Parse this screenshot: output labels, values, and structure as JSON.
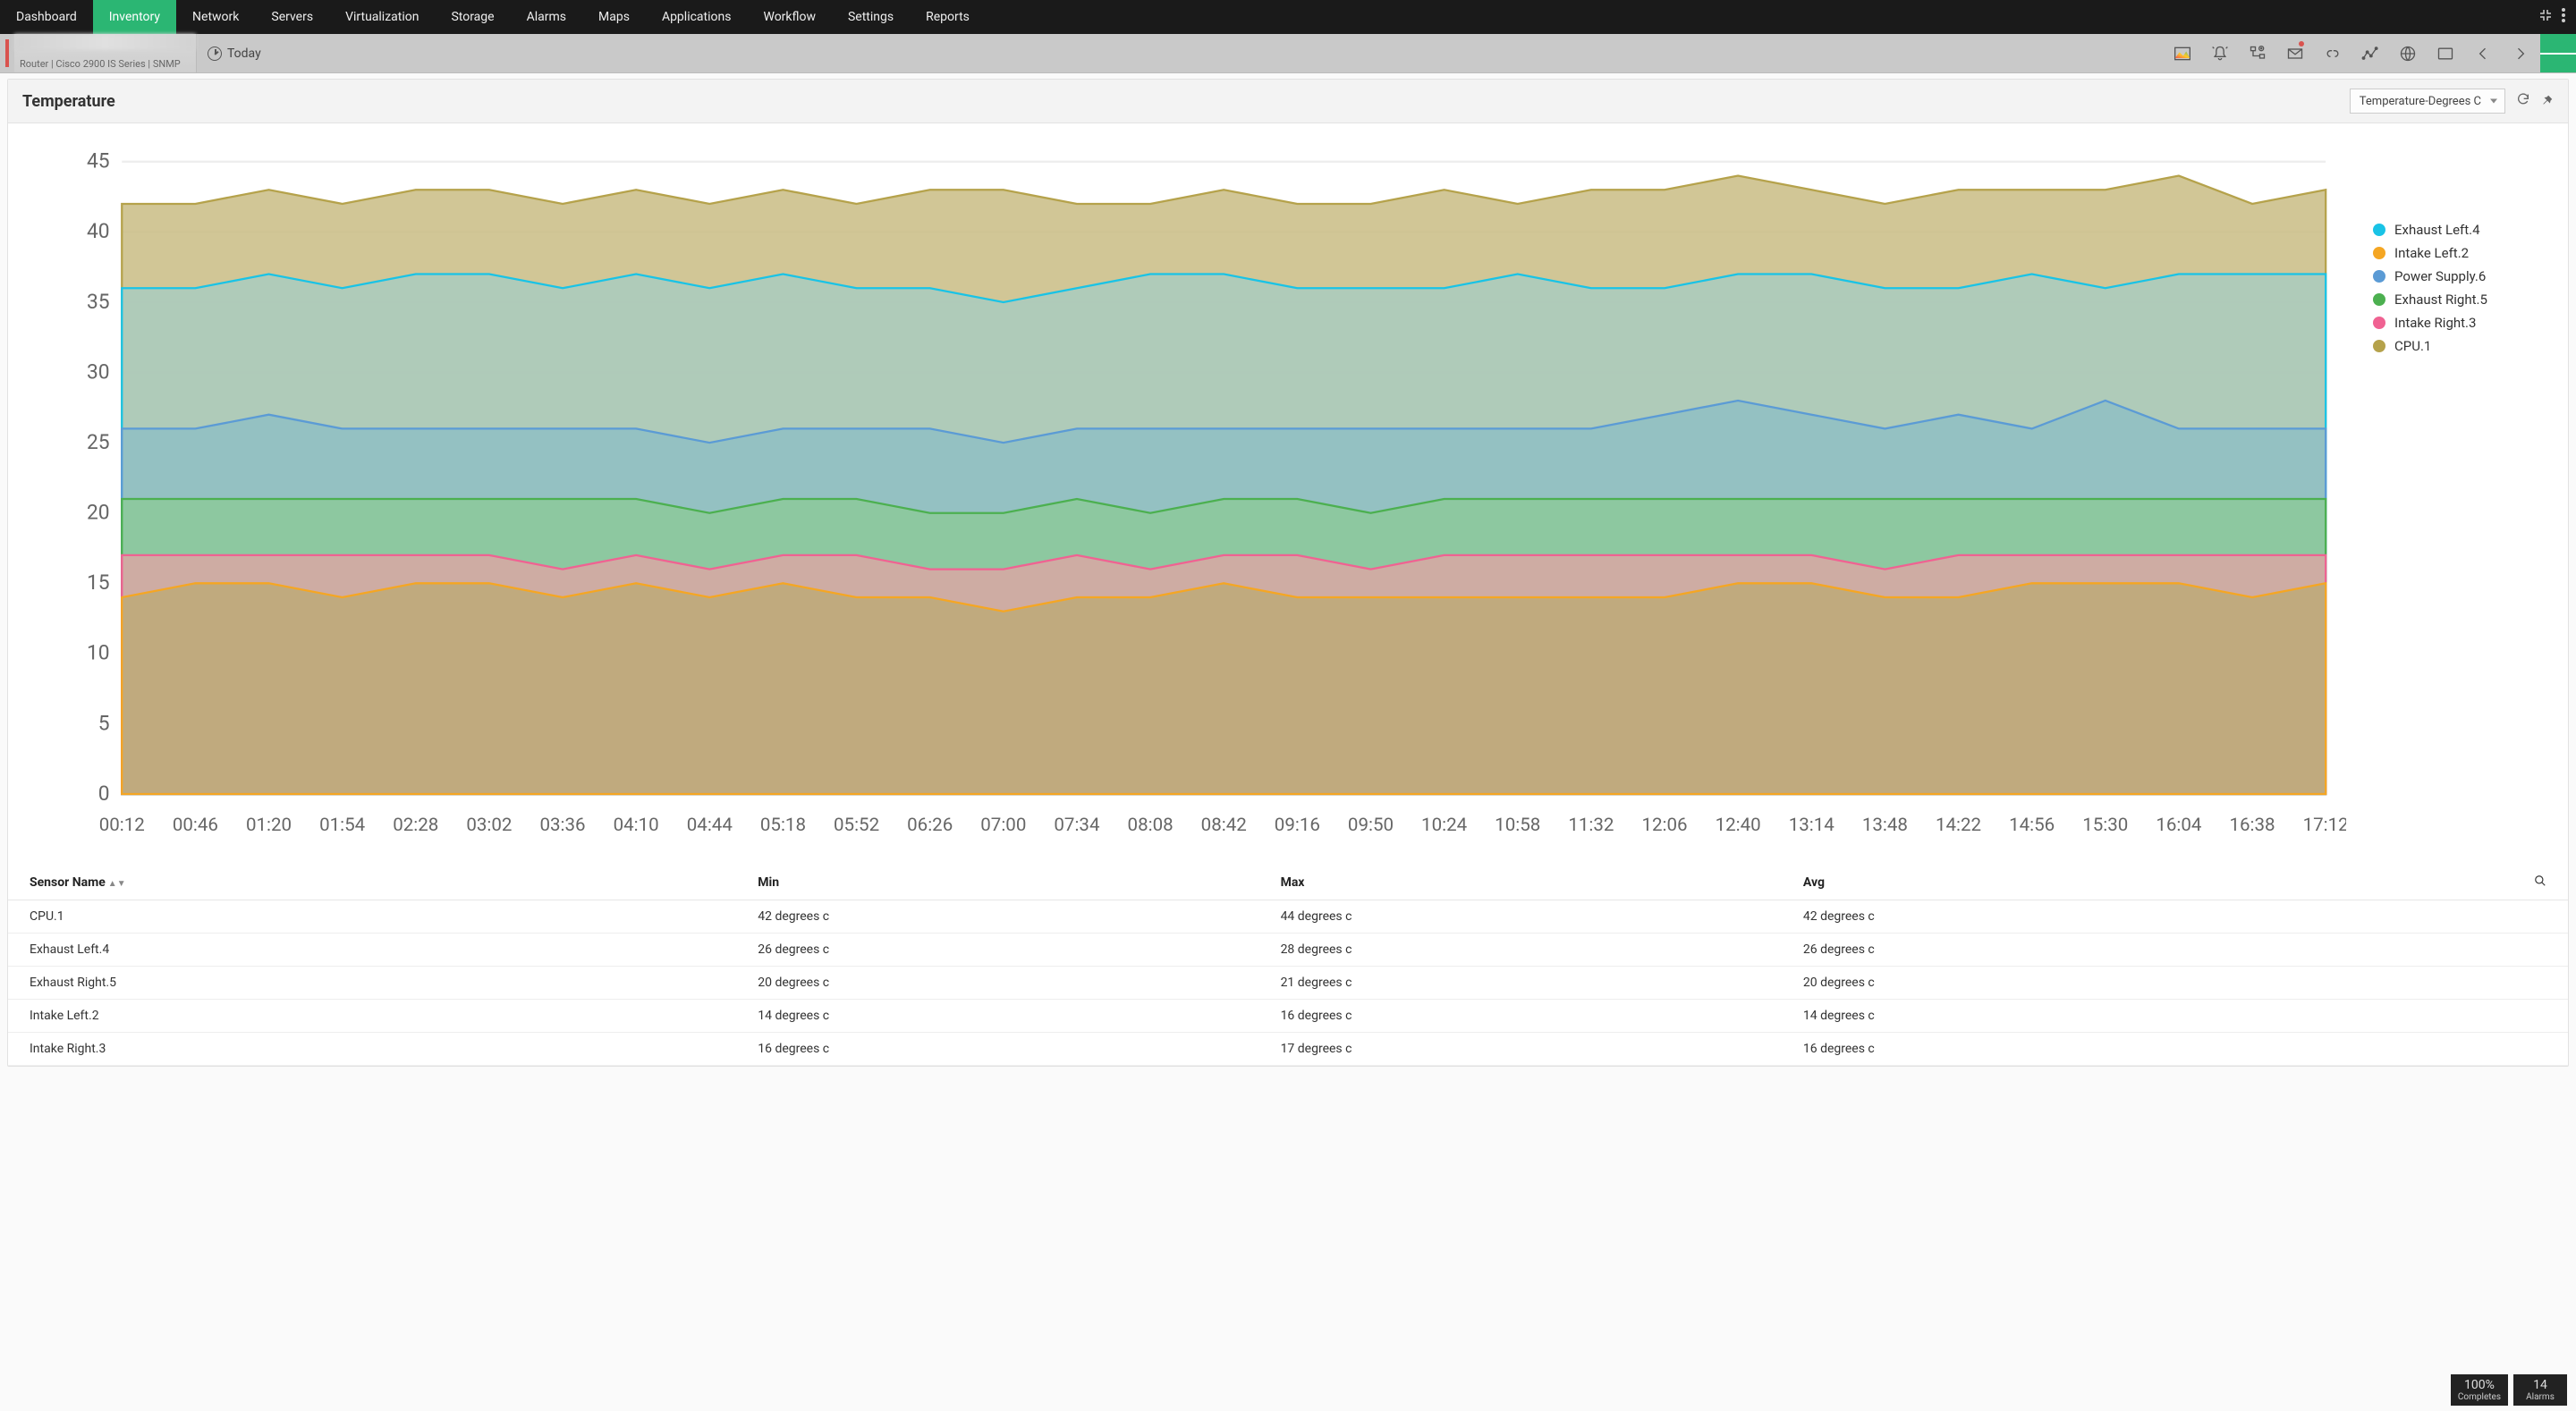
{
  "nav": {
    "items": [
      "Dashboard",
      "Inventory",
      "Network",
      "Servers",
      "Virtualization",
      "Storage",
      "Alarms",
      "Maps",
      "Applications",
      "Workflow",
      "Settings",
      "Reports"
    ],
    "active_index": 1
  },
  "subheader": {
    "device_meta": "Router | Cisco 2900 IS Series | SNMP",
    "time_label": "Today"
  },
  "card": {
    "title": "Temperature",
    "metric_select": "Temperature-Degrees C"
  },
  "legend": [
    {
      "label": "Exhaust Left.4",
      "color": "#19c3e6"
    },
    {
      "label": "Intake Left.2",
      "color": "#f5a623"
    },
    {
      "label": "Power Supply.6",
      "color": "#5b9bd5"
    },
    {
      "label": "Exhaust Right.5",
      "color": "#4cb050"
    },
    {
      "label": "Intake Right.3",
      "color": "#f06292"
    },
    {
      "label": "CPU.1",
      "color": "#b5a24b"
    }
  ],
  "table": {
    "columns": [
      "Sensor Name",
      "Min",
      "Max",
      "Avg"
    ],
    "rows": [
      {
        "name": "CPU.1",
        "min": "42 degrees c",
        "max": "44 degrees c",
        "avg": "42 degrees c"
      },
      {
        "name": "Exhaust Left.4",
        "min": "26 degrees c",
        "max": "28 degrees c",
        "avg": "26 degrees c"
      },
      {
        "name": "Exhaust Right.5",
        "min": "20 degrees c",
        "max": "21 degrees c",
        "avg": "20 degrees c"
      },
      {
        "name": "Intake Left.2",
        "min": "14 degrees c",
        "max": "16 degrees c",
        "avg": "14 degrees c"
      },
      {
        "name": "Intake Right.3",
        "min": "16 degrees c",
        "max": "17 degrees c",
        "avg": "16 degrees c"
      }
    ]
  },
  "footer": {
    "completes_pct": "100%",
    "completes_label": "Completes",
    "alarms_count": "14",
    "alarms_label": "Alarms"
  },
  "chart_data": {
    "type": "area",
    "stacked": false,
    "ylabel": "",
    "xlabel": "",
    "ylim": [
      0,
      45
    ],
    "yticks": [
      0,
      5,
      10,
      15,
      20,
      25,
      30,
      35,
      40,
      45
    ],
    "categories": [
      "00:12",
      "00:46",
      "01:20",
      "01:54",
      "02:28",
      "03:02",
      "03:36",
      "04:10",
      "04:44",
      "05:18",
      "05:52",
      "06:26",
      "07:00",
      "07:34",
      "08:08",
      "08:42",
      "09:16",
      "09:50",
      "10:24",
      "10:58",
      "11:32",
      "12:06",
      "12:40",
      "13:14",
      "13:48",
      "14:22",
      "14:56",
      "15:30",
      "16:04",
      "16:38",
      "17:12"
    ],
    "series": [
      {
        "name": "CPU.1",
        "color": "#b5a24b",
        "fill": "#c9bc84",
        "values": [
          42,
          42,
          43,
          42,
          43,
          43,
          42,
          43,
          42,
          43,
          42,
          43,
          43,
          42,
          42,
          43,
          42,
          42,
          43,
          42,
          43,
          43,
          44,
          43,
          42,
          43,
          43,
          43,
          44,
          42,
          43
        ]
      },
      {
        "name": "Exhaust Left.4",
        "color": "#19c3e6",
        "fill": "#a9cbc0",
        "values": [
          36,
          36,
          37,
          36,
          37,
          37,
          36,
          37,
          36,
          37,
          36,
          36,
          35,
          36,
          37,
          37,
          36,
          36,
          36,
          37,
          36,
          36,
          37,
          37,
          36,
          36,
          37,
          36,
          37,
          37,
          37
        ]
      },
      {
        "name": "Power Supply.6",
        "color": "#5b9bd5",
        "fill": "#8fbfc3",
        "values": [
          26,
          26,
          27,
          26,
          26,
          26,
          26,
          26,
          25,
          26,
          26,
          26,
          25,
          26,
          26,
          26,
          26,
          26,
          26,
          26,
          26,
          27,
          28,
          27,
          26,
          27,
          26,
          28,
          26,
          26,
          26
        ]
      },
      {
        "name": "Exhaust Right.5",
        "color": "#4cb050",
        "fill": "#8cc99a",
        "values": [
          21,
          21,
          21,
          21,
          21,
          21,
          21,
          21,
          20,
          21,
          21,
          20,
          20,
          21,
          20,
          21,
          21,
          20,
          21,
          21,
          21,
          21,
          21,
          21,
          21,
          21,
          21,
          21,
          21,
          21,
          21
        ]
      },
      {
        "name": "Intake Right.3",
        "color": "#f06292",
        "fill": "#d9a7a3",
        "values": [
          17,
          17,
          17,
          17,
          17,
          17,
          16,
          17,
          16,
          17,
          17,
          16,
          16,
          17,
          16,
          17,
          17,
          16,
          17,
          17,
          17,
          17,
          17,
          17,
          16,
          17,
          17,
          17,
          17,
          17,
          17
        ]
      },
      {
        "name": "Intake Left.2",
        "color": "#f5a623",
        "fill": "#bda978",
        "values": [
          14,
          15,
          15,
          14,
          15,
          15,
          14,
          15,
          14,
          15,
          14,
          14,
          13,
          14,
          14,
          15,
          14,
          14,
          14,
          14,
          14,
          14,
          15,
          15,
          14,
          14,
          15,
          15,
          15,
          14,
          15
        ]
      }
    ]
  }
}
